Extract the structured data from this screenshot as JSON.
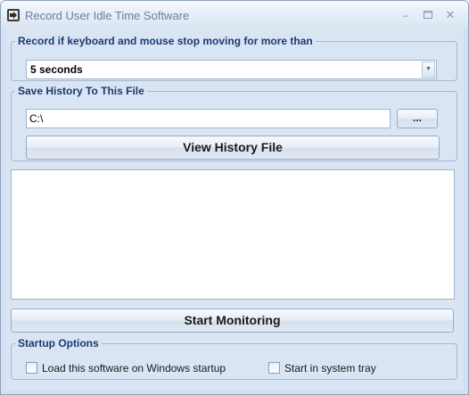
{
  "window": {
    "title": "Record User Idle Time Software",
    "minimize_icon": "minimize-icon",
    "maximize_icon": "maximize-icon",
    "close_icon": "close-icon"
  },
  "idle_group": {
    "legend": "Record if keyboard and mouse stop moving for more than",
    "selected_value": "5 seconds"
  },
  "history_group": {
    "legend": "Save History To This File",
    "path_value": "C:\\",
    "browse_label": "...",
    "view_history_label": "View History File"
  },
  "monitor": {
    "start_label": "Start Monitoring"
  },
  "startup_group": {
    "legend": "Startup Options",
    "load_on_startup_label": "Load this software on Windows startup",
    "load_on_startup_checked": false,
    "start_in_tray_label": "Start in system tray",
    "start_in_tray_checked": false
  },
  "colors": {
    "window_bg": "#d9e5f3",
    "legend_text": "#1b3a73",
    "border": "#a4b8d4"
  }
}
